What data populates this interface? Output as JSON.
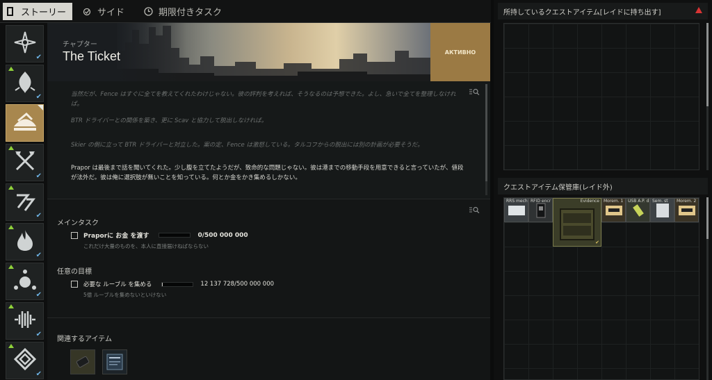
{
  "tabs": {
    "story": "ストーリー",
    "side": "サイド",
    "timed": "期限付きタスク"
  },
  "traders": [
    {
      "icon": "prapor-star-icon",
      "new": false,
      "done": true
    },
    {
      "icon": "therapist-icon",
      "new": true,
      "done": true
    },
    {
      "icon": "fence-icon",
      "new": false,
      "done": false,
      "active": true
    },
    {
      "icon": "crossed-axes-icon",
      "new": true,
      "done": true
    },
    {
      "icon": "peacekeeper-icon",
      "new": true,
      "done": true
    },
    {
      "icon": "flame-icon",
      "new": true,
      "done": true
    },
    {
      "icon": "globe-icon",
      "new": true,
      "done": true
    },
    {
      "icon": "soundwave-icon",
      "new": true,
      "done": true
    },
    {
      "icon": "lightkeeper-icon",
      "new": true,
      "done": true
    }
  ],
  "quest": {
    "chapter_label": "チャプター",
    "title": "The Ticket",
    "status": "АКТИВНО",
    "description": [
      "当然だが、Fence はすぐに全てを教えてくれたわけじゃない。彼の評判を考えれば、そうなるのは予想できた。よし、急いで全てを整理しなければ。",
      "BTR ドライバーとの関係を築き、更に Scav と協力して脱出しなければ。",
      "Skier の側に立って BTR ドライバーと対立した。案の定、Fence は激怒している。タルコフからの脱出には別の計画が必要そうだ。",
      "Prapor は最後まで話を聞いてくれた。少し腹を立てたようだが、致命的な問題じゃない。彼は港までの移動手段を用意できると言っていたが、値段が法外だ。彼は俺に選択肢が無いことを知っている。何とか金をかき集めるしかない。"
    ],
    "main_task_title": "メインタスク",
    "main_task": {
      "label": "Praporに お金 を渡す",
      "progress": "0/500 000 000",
      "fraction": 0,
      "sub": "これだけ大量のものを、本人に直接届けねばならない"
    },
    "optional_title": "任意の目標",
    "optional_task": {
      "label": "必要な ルーブル を集める",
      "progress": "12 137 728/500 000 000",
      "fraction": 0.024,
      "sub": "5億 ルーブルを集めないといけない"
    },
    "related_title": "関連するアイテム"
  },
  "right": {
    "owned_title": "所持しているクエストアイテム[レイドに持ち出す]",
    "stash_title": "クエストアイテム保管庫(レイド外)",
    "items": [
      {
        "name": "RRS mech"
      },
      {
        "name": "RFID encr"
      },
      {
        "name": "Evidence"
      },
      {
        "name": "Morem. 1"
      },
      {
        "name": "USB A.P. d"
      },
      {
        "name": "Sem. st"
      },
      {
        "name": "Morem. 2"
      }
    ]
  },
  "colors": {
    "accent": "#a8874e",
    "check": "#6fb6e9",
    "new": "#8fd13a",
    "warning": "#d83434"
  }
}
